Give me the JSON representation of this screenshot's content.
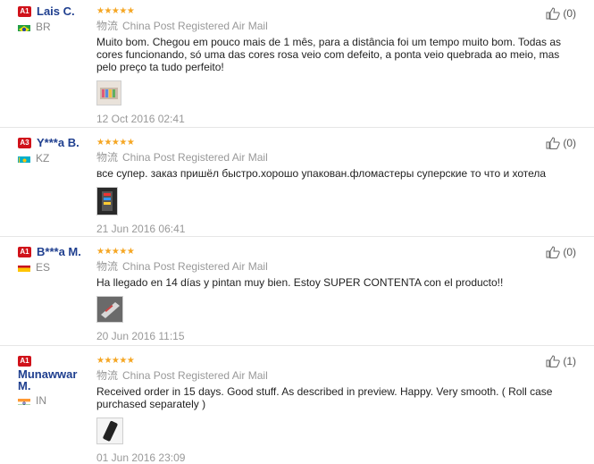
{
  "reviews": [
    {
      "level": "A1",
      "name": "Lais C.",
      "country_code": "BR",
      "flag": "brazil",
      "stars": "★★★★★",
      "rating": 5,
      "logistics_cn": "物流",
      "logistics": "China Post Registered Air Mail",
      "text": "Muito bom. Chegou em pouco mais de 1 mês, para a distância foi um tempo muito bom. Todas as cores funcionando, só uma das cores rosa veio com defeito, a ponta veio quebrada ao meio, mas pelo preço ta tudo perfeito!",
      "date": "12 Oct 2016 02:41",
      "helpful": "(0)"
    },
    {
      "level": "A3",
      "name": "Y***a B.",
      "country_code": "KZ",
      "flag": "kazakhstan",
      "stars": "★★★★★",
      "rating": 5,
      "logistics_cn": "物流",
      "logistics": "China Post Registered Air Mail",
      "text": "все супер. заказ пришёл быстро.хорошо упакован.фломастеры суперские то что и хотела",
      "date": "21 Jun 2016 06:41",
      "helpful": "(0)"
    },
    {
      "level": "A1",
      "name": "B***a M.",
      "country_code": "ES",
      "flag": "spain",
      "stars": "★★★★★",
      "rating": 5,
      "logistics_cn": "物流",
      "logistics": "China Post Registered Air Mail",
      "text": "Ha llegado en 14 días y pintan muy bien. Estoy SUPER CONTENTA con el producto!!",
      "date": "20 Jun 2016 11:15",
      "helpful": "(0)"
    },
    {
      "level": "A1",
      "name": "Munawwar M.",
      "country_code": "IN",
      "flag": "india",
      "stars": "★★★★★",
      "rating": 5,
      "logistics_cn": "物流",
      "logistics": "China Post Registered Air Mail",
      "text": "Received order in 15 days. Good stuff. As described in preview. Happy. Very smooth. ( Roll case purchased separately )",
      "date": "01 Jun 2016 23:09",
      "helpful": "(1)"
    }
  ],
  "colors": {
    "name": "#1f3f8f",
    "badge": "#d0121a",
    "stars": "#f5a623",
    "muted": "#999999"
  },
  "icons": {
    "helpful": "thumbs-up-icon"
  }
}
